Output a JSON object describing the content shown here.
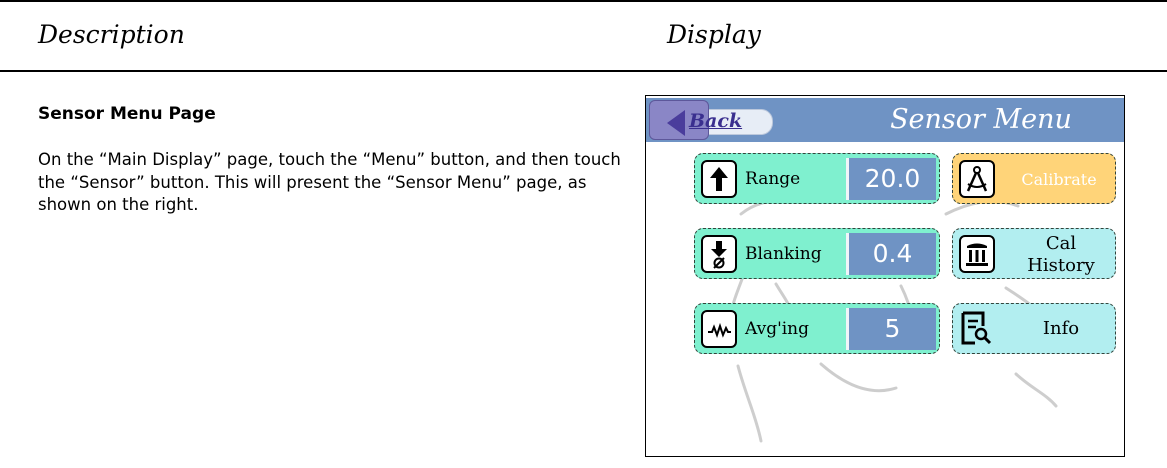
{
  "header": {
    "description": "Description",
    "display": "Display"
  },
  "section": {
    "title": "Sensor Menu Page",
    "body": "On the “Main Display” page, touch the “Menu” button, and then touch the “Sensor” button.  This will present the “Sensor Menu” page, as shown on the right."
  },
  "screen": {
    "title": "Sensor Menu",
    "back_label": "Back",
    "left_buttons": [
      {
        "label": "Range",
        "value": "20.0",
        "icon": "up-arrow-icon"
      },
      {
        "label": "Blanking",
        "value": "0.4",
        "icon": "blanking-down-arrow-icon"
      },
      {
        "label": "Avg'ing",
        "value": "5",
        "icon": "waveform-icon"
      }
    ],
    "right_buttons": [
      {
        "label": "Calibrate",
        "icon": "compass-icon"
      },
      {
        "label_line1": "Cal",
        "label_line2": "History",
        "icon": "column-history-icon"
      },
      {
        "label": "Info",
        "icon": "document-search-icon"
      }
    ]
  },
  "colors": {
    "title_bar": "#6f93c4",
    "green_button": "#7ff0cf",
    "orange_button": "#ffd479",
    "cyan_button": "#b2eef0",
    "back_tab": "#8a86c6"
  }
}
